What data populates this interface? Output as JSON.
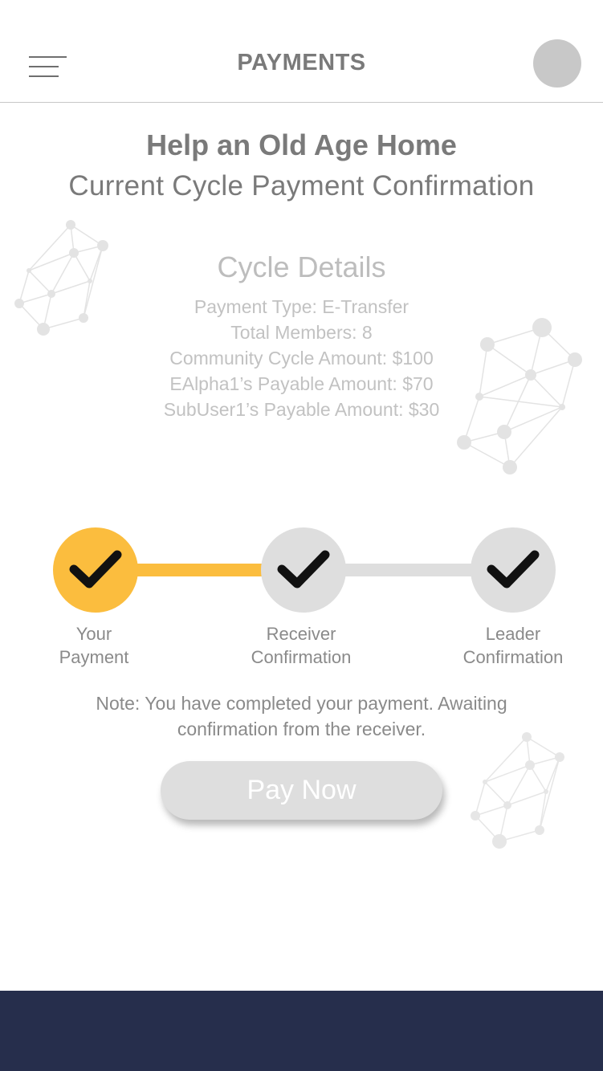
{
  "header": {
    "title": "PAYMENTS",
    "menu_icon": "hamburger-menu-icon",
    "avatar_icon": "user-avatar"
  },
  "group": {
    "title": "Help an Old Age Home",
    "subtitle": "Current Cycle Payment Confirmation"
  },
  "cycle": {
    "title": "Cycle Details",
    "payment_type": "Payment Type: E-Transfer",
    "total_members": "Total Members: 8",
    "community_amount": "Community Cycle Amount: $100",
    "user_payable": "EAlpha1’s Payable Amount: $70",
    "subuser_payable": "SubUser1’s Payable Amount: $30"
  },
  "steps": [
    {
      "line1": "Your",
      "line2": "Payment",
      "status": "complete",
      "icon": "check-icon"
    },
    {
      "line1": "Receiver",
      "line2": "Confirmation",
      "status": "pending",
      "icon": "check-icon"
    },
    {
      "line1": "Leader",
      "line2": "Confirmation",
      "status": "pending",
      "icon": "check-icon"
    }
  ],
  "note": {
    "line1": "Note: You have completed your payment. Awaiting",
    "line2": "confirmation from the receiver."
  },
  "actions": {
    "pay_now": "Pay Now"
  },
  "colors": {
    "accent": "#fbbd3e",
    "inactive": "#dedede",
    "text": "#7a7a7a",
    "footer": "#262e4c"
  }
}
